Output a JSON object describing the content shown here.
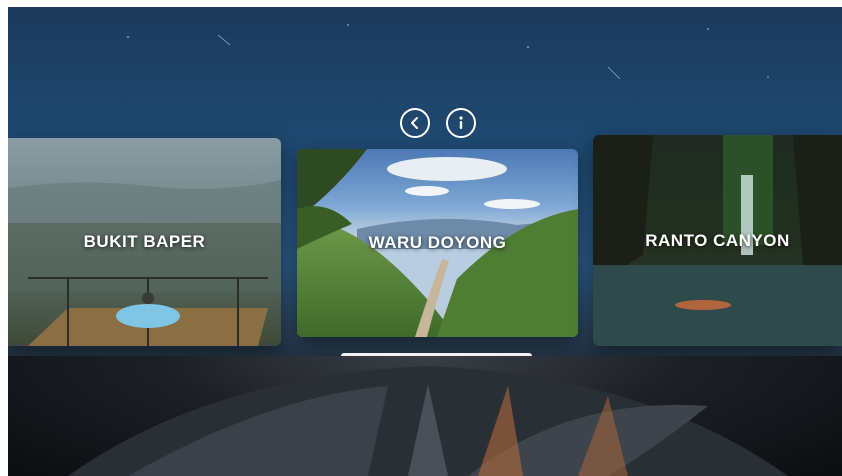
{
  "controls": {
    "back_icon": "chevron-left-icon",
    "info_icon": "info-icon"
  },
  "carousel": {
    "cards": [
      {
        "title": "BUKIT BAPER",
        "position": "left"
      },
      {
        "title": "WARU DOYONG",
        "position": "center"
      },
      {
        "title": "RANTO CANYON",
        "position": "right"
      }
    ]
  },
  "colors": {
    "sky_top": "#1b3a5c",
    "sky_horizon": "#2a5a86",
    "text": "#ffffff"
  }
}
